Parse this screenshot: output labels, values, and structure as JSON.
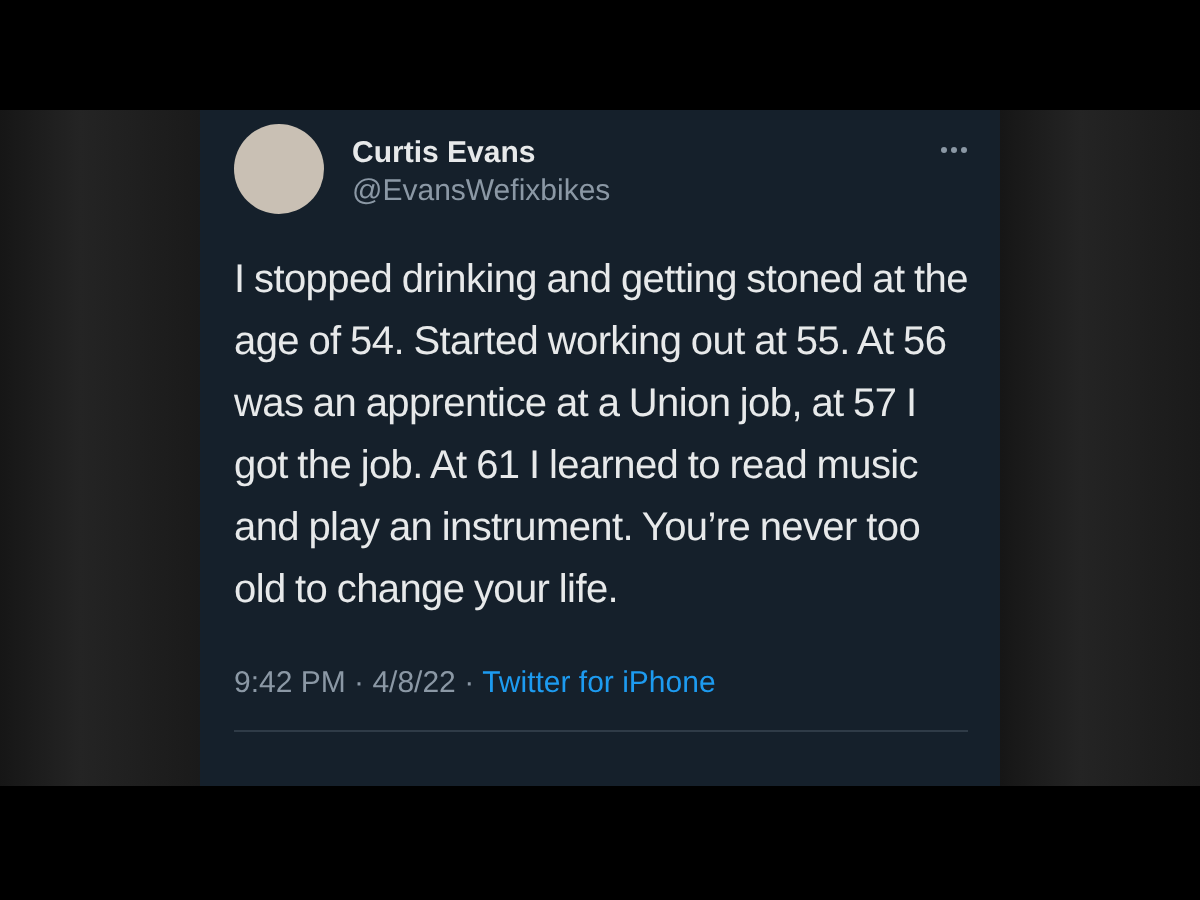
{
  "tweet": {
    "name": "Curtis Evans",
    "handle": "@EvansWefixbikes",
    "text": "I stopped drinking and getting stoned at the age of 54.  Started working out at 55.  At 56 was an apprentice at a Union job, at 57 I got the job. At 61 I learned to read music and play an instrument. You’re never too old to change your life.",
    "time": "9:42 PM · 4/8/22 ·",
    "source": "Twitter for iPhone"
  }
}
